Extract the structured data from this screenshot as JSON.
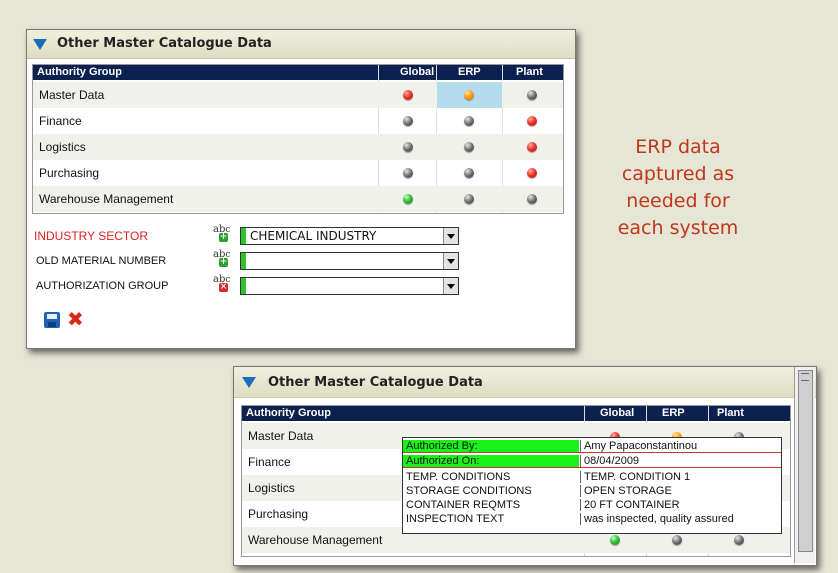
{
  "panel1": {
    "title": "Other Master Catalogue Data",
    "columns": {
      "group": "Authority Group",
      "global": "Global",
      "erp": "ERP",
      "plant": "Plant"
    },
    "rows": [
      {
        "label": "Master Data",
        "global": "red",
        "erp": "orange",
        "plant": "grey",
        "erp_selected": true
      },
      {
        "label": "Finance",
        "global": "grey",
        "erp": "grey",
        "plant": "red"
      },
      {
        "label": "Logistics",
        "global": "grey",
        "erp": "grey",
        "plant": "red"
      },
      {
        "label": "Purchasing",
        "global": "grey",
        "erp": "grey",
        "plant": "red"
      },
      {
        "label": "Warehouse Management",
        "global": "green",
        "erp": "grey",
        "plant": "grey"
      }
    ],
    "fields": [
      {
        "label": "INDUSTRY SECTOR",
        "required": true,
        "value": "CHEMICAL INDUSTRY",
        "icon": "abc-add-icon"
      },
      {
        "label": "OLD MATERIAL NUMBER",
        "required": false,
        "value": "",
        "icon": "abc-add-icon"
      },
      {
        "label": "AUTHORIZATION GROUP",
        "required": false,
        "value": "",
        "icon": "abc-remove-icon"
      }
    ],
    "actions": {
      "save": "save-icon",
      "cancel": "cancel-icon"
    }
  },
  "caption": {
    "line1": "ERP data",
    "line2": "captured as",
    "line3": "needed for",
    "line4": "each system",
    "color": "#c1371b"
  },
  "panel2": {
    "title": "Other Master Catalogue Data",
    "columns": {
      "group": "Authority Group",
      "global": "Global",
      "erp": "ERP",
      "plant": "Plant"
    },
    "rows": [
      {
        "label": "Master Data"
      },
      {
        "label": "Finance"
      },
      {
        "label": "Logistics"
      },
      {
        "label": "Purchasing"
      },
      {
        "label": "Warehouse Management",
        "global": "green",
        "erp": "grey",
        "plant": "grey"
      }
    ]
  },
  "tooltip": {
    "rows": [
      {
        "key": "Authorized By:",
        "value": "Amy Papaconstantinou"
      },
      {
        "key": "Authorized On:",
        "value": "08/04/2009"
      },
      {
        "key": "TEMP. CONDITIONS",
        "value": "TEMP. CONDITION 1"
      },
      {
        "key": "STORAGE CONDITIONS",
        "value": "OPEN STORAGE"
      },
      {
        "key": "CONTAINER REQMTS",
        "value": "20 FT CONTAINER"
      },
      {
        "key": "INSPECTION TEXT",
        "value": "was inspected, quality assured"
      }
    ]
  },
  "colors": {
    "header_navy": "#0d2150",
    "accent_blue": "#1a6fbd",
    "required_red": "#e02020",
    "highlight_green": "#19f21a"
  }
}
